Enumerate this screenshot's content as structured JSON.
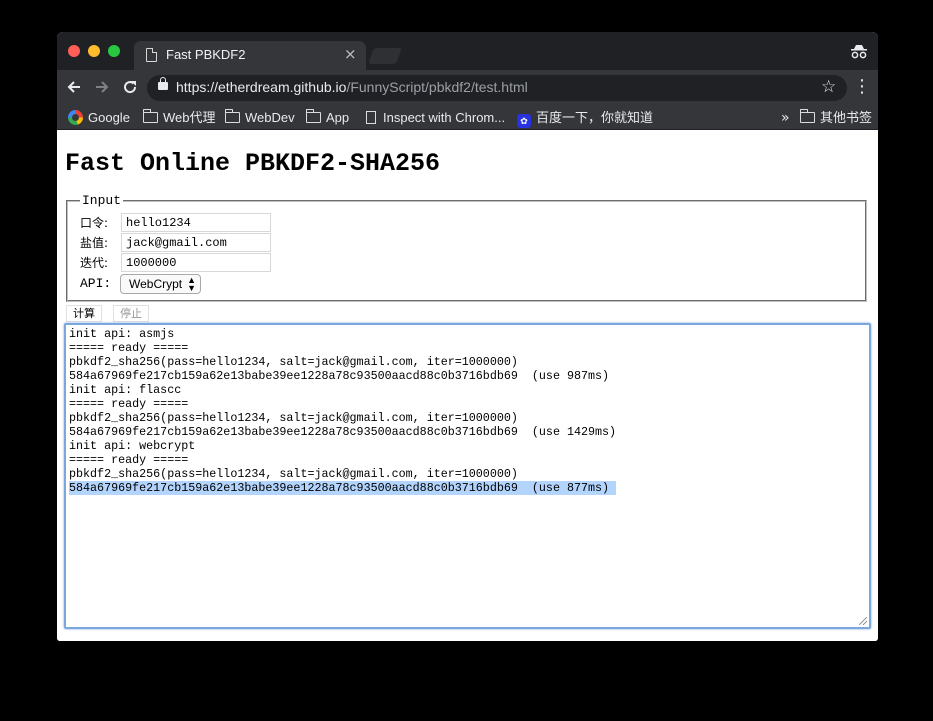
{
  "browser": {
    "tab_title": "Fast PBKDF2",
    "tab_close": "×",
    "url_host": "https://etherdream.github.io",
    "url_path": "/FunnyScript/pbkdf2/test.html",
    "icons": {
      "back": "arrow-left-icon",
      "forward": "arrow-right-icon",
      "reload": "reload-icon",
      "star": "star-icon",
      "menu": "kebab-menu-icon",
      "incognito": "incognito-icon"
    },
    "colors": {
      "tabstrip": "#202124",
      "toolbar": "#35363a",
      "close": "#fe5f57",
      "minimize": "#febc2e",
      "maximize": "#28c840"
    }
  },
  "bookmarks": {
    "items": [
      {
        "label": "Google",
        "icon": "google-icon"
      },
      {
        "label": "Web代理",
        "icon": "folder-icon"
      },
      {
        "label": "WebDev",
        "icon": "folder-icon"
      },
      {
        "label": "App",
        "icon": "folder-icon"
      },
      {
        "label": "Inspect with Chrom...",
        "icon": "page-icon"
      },
      {
        "label": "百度一下，你就知道",
        "icon": "baidu-paw-icon"
      }
    ],
    "overflow": "»",
    "other": "其他书签"
  },
  "page": {
    "title": "Fast Online PBKDF2-SHA256",
    "legend": "Input",
    "fields": [
      {
        "label": "口令:",
        "value": "hello1234"
      },
      {
        "label": "盐值:",
        "value": "jack@gmail.com"
      },
      {
        "label": "迭代:",
        "value": "1000000"
      }
    ],
    "api_label": "API:",
    "api_value": "WebCrypt",
    "calc_button": "计算",
    "stop_button": "停止",
    "log": [
      "init api: asmjs",
      "===== ready =====",
      "pbkdf2_sha256(pass=hello1234, salt=jack@gmail.com, iter=1000000)",
      "584a67969fe217cb159a62e13babe39ee1228a78c93500aacd88c0b3716bdb69  (use 987ms)",
      "init api: flascc",
      "===== ready =====",
      "pbkdf2_sha256(pass=hello1234, salt=jack@gmail.com, iter=1000000)",
      "584a67969fe217cb159a62e13babe39ee1228a78c93500aacd88c0b3716bdb69  (use 1429ms)",
      "init api: webcrypt",
      "===== ready =====",
      "pbkdf2_sha256(pass=hello1234, salt=jack@gmail.com, iter=1000000)",
      "584a67969fe217cb159a62e13babe39ee1228a78c93500aacd88c0b3716bdb69  (use 877ms) "
    ]
  }
}
